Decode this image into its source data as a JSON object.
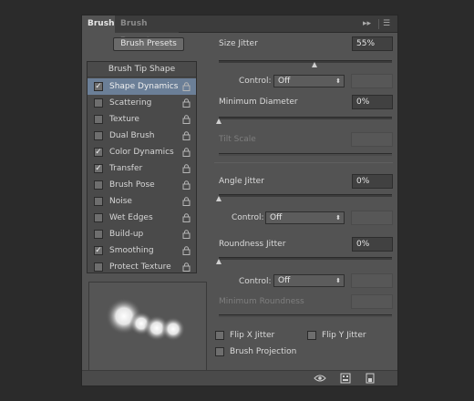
{
  "tabs": {
    "brush": "Brush",
    "brush_presets": "Brush Presets"
  },
  "tab_controls": {
    "expand": "▸▸",
    "menu": "☰"
  },
  "presets_button": "Brush Presets",
  "list": {
    "title": "Brush Tip Shape",
    "items": [
      {
        "label": "Shape Dynamics",
        "checked": true
      },
      {
        "label": "Scattering",
        "checked": false
      },
      {
        "label": "Texture",
        "checked": false
      },
      {
        "label": "Dual Brush",
        "checked": false
      },
      {
        "label": "Color Dynamics",
        "checked": true
      },
      {
        "label": "Transfer",
        "checked": true
      },
      {
        "label": "Brush Pose",
        "checked": false
      },
      {
        "label": "Noise",
        "checked": false
      },
      {
        "label": "Wet Edges",
        "checked": false
      },
      {
        "label": "Build-up",
        "checked": false
      },
      {
        "label": "Smoothing",
        "checked": true
      },
      {
        "label": "Protect Texture",
        "checked": false
      }
    ]
  },
  "size_jitter": {
    "label": "Size Jitter",
    "value": "55%",
    "control_label": "Control:",
    "control_value": "Off"
  },
  "min_diameter": {
    "label": "Minimum Diameter",
    "value": "0%"
  },
  "tilt_scale": {
    "label": "Tilt Scale"
  },
  "angle_jitter": {
    "label": "Angle Jitter",
    "value": "0%",
    "control_label": "Control:",
    "control_value": "Off"
  },
  "roundness_jitter": {
    "label": "Roundness Jitter",
    "value": "0%",
    "control_label": "Control:",
    "control_value": "Off"
  },
  "min_roundness": {
    "label": "Minimum Roundness"
  },
  "flip_x": "Flip X Jitter",
  "flip_y": "Flip Y Jitter",
  "brush_projection": "Brush Projection",
  "slider_levels": {
    "size_jitter": 0.55,
    "min_diameter": 0,
    "angle_jitter": 0,
    "roundness_jitter": 0
  }
}
